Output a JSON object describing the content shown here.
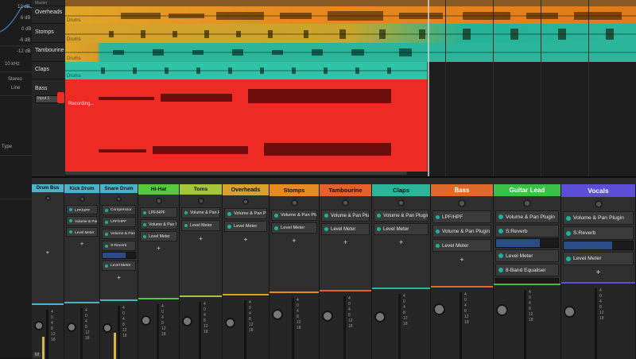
{
  "left_panel": {
    "db_labels": [
      "12 dB",
      "6 dB",
      "0 dB",
      "-6 dB",
      "-12 dB"
    ],
    "freq_label": "10 kHz",
    "items": [
      "Stereo",
      "Line",
      "Type"
    ]
  },
  "arrange": {
    "tracks": [
      {
        "name": "Overheads",
        "clip": "Drums",
        "color": "#e8891f"
      },
      {
        "name": "Stomps",
        "clip": "Drums",
        "color": "#d8a12a"
      },
      {
        "name": "Tambourine",
        "clip": "Drums",
        "color": "#2bb69c"
      },
      {
        "name": "Claps",
        "clip": "Drums",
        "color": "#2fc4a8"
      },
      {
        "name": "Bass",
        "clip": "Recording...",
        "color": "#ee2a24"
      }
    ],
    "bass_input": "Input 1",
    "top_partial_label": "Master"
  },
  "mixer": {
    "strips": [
      {
        "name": "Drum Bus",
        "color": "#4ab3c9",
        "plugins": [],
        "add": "+"
      },
      {
        "name": "Kick Drum",
        "color": "#4ab3c9",
        "plugins": [
          "LPF/HPF",
          "Volume & Pan Plugin",
          "Level Meter"
        ],
        "add": "+"
      },
      {
        "name": "Snare Drum",
        "color": "#4ab3c9",
        "plugins": [
          "Compressor",
          "LPF/HPF",
          "Volume & Pan Plugin",
          "S:Reverb",
          "Level Meter"
        ],
        "add": "+"
      },
      {
        "name": "Hi-Hat",
        "color": "#55c83c",
        "plugins": [
          "LPF/HPF",
          "Volume & Pan Plugin",
          "Level Meter"
        ],
        "add": "+"
      },
      {
        "name": "Toms",
        "color": "#a6c63a",
        "plugins": [
          "Volume & Pan Plugin",
          "Level Meter"
        ],
        "add": "+"
      },
      {
        "name": "Overheads",
        "color": "#d8a12a",
        "plugins": [
          "Volume & Pan Plugin",
          "Level Meter"
        ],
        "add": "+"
      },
      {
        "name": "Stomps",
        "color": "#e58b22",
        "plugins": [
          "Volume & Pan Plugin",
          "Level Meter"
        ],
        "add": "+"
      },
      {
        "name": "Tambourine",
        "color": "#e2622a",
        "plugins": [
          "Volume & Pan Plugin",
          "Level Meter"
        ],
        "add": "+"
      },
      {
        "name": "Claps",
        "color": "#2bb69c",
        "plugins": [
          "Volume & Pan Plugin",
          "Level Meter"
        ],
        "add": "+"
      },
      {
        "name": "Bass",
        "color": "#e06a2c",
        "plugins": [
          "LPF/HPF",
          "Volume & Pan Plugin",
          "Level Meter"
        ],
        "add": "+"
      },
      {
        "name": "Guitar Lead",
        "color": "#39c14a",
        "plugins": [
          "Volume & Pan Plugin",
          "S:Reverb",
          "Level Meter",
          "8-Band Equaliser"
        ],
        "add": "+"
      },
      {
        "name": "Vocals",
        "color": "#5b4fd8",
        "plugins": [
          "Volume & Pan Plugin",
          "S:Reverb",
          "Level Meter"
        ],
        "add": "+"
      }
    ],
    "fader_scale": [
      "4",
      "0",
      "4",
      "8",
      "12",
      "18"
    ],
    "mute_label": "M"
  }
}
